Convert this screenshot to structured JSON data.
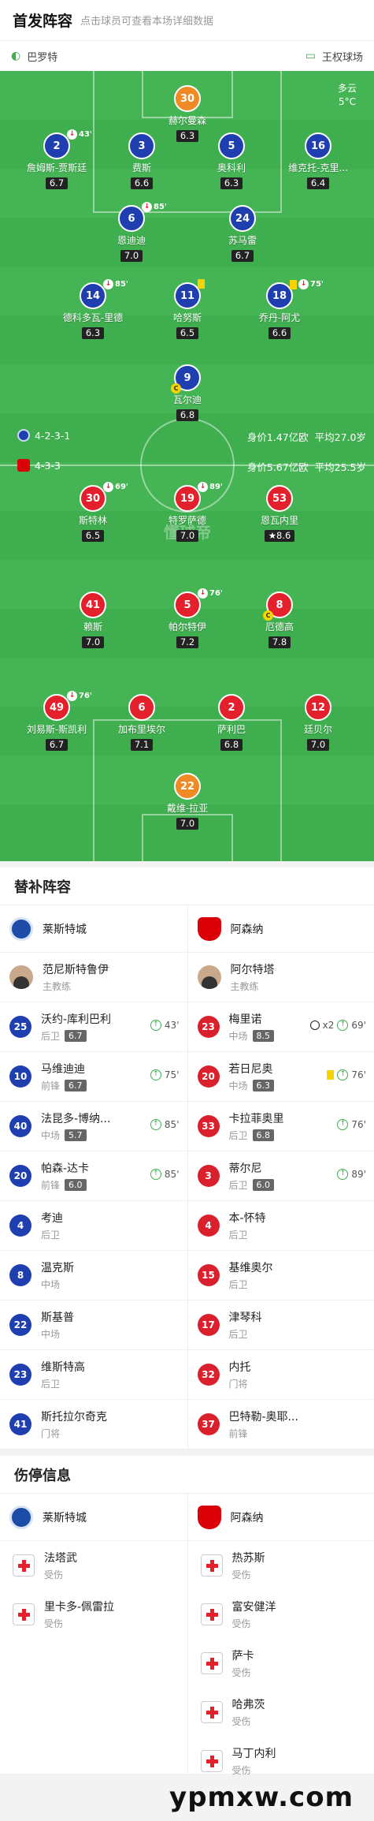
{
  "header": {
    "title": "首发阵容",
    "hint": "点击球员可查看本场详细数据"
  },
  "teambar": {
    "left": "巴罗特",
    "right": "王权球场"
  },
  "weather": {
    "condition": "多云",
    "temp": "5°C"
  },
  "home": {
    "formation": "4-2-3-1",
    "value": "身价1.47亿欧",
    "avg_age": "平均27.0岁",
    "players": [
      {
        "no": "30",
        "name": "赫尔曼森",
        "rating": "6.3",
        "keeper": true
      },
      {
        "no": "2",
        "name": "詹姆斯-贾斯廷",
        "rating": "6.7",
        "sub": "43'"
      },
      {
        "no": "3",
        "name": "费斯",
        "rating": "6.6"
      },
      {
        "no": "5",
        "name": "奥科利",
        "rating": "6.3"
      },
      {
        "no": "16",
        "name": "维克托-克里...",
        "rating": "6.4"
      },
      {
        "no": "6",
        "name": "恩迪迪",
        "rating": "7.0",
        "sub": "85'"
      },
      {
        "no": "24",
        "name": "苏马雷",
        "rating": "6.7"
      },
      {
        "no": "14",
        "name": "德科多瓦-里德",
        "rating": "6.3",
        "sub": "85'"
      },
      {
        "no": "11",
        "name": "哈努斯",
        "rating": "6.5",
        "yellow": true
      },
      {
        "no": "18",
        "name": "乔丹-阿尤",
        "rating": "6.6",
        "sub": "75'",
        "yellow": true
      },
      {
        "no": "9",
        "name": "瓦尔迪",
        "rating": "6.8",
        "captain": true
      }
    ]
  },
  "away": {
    "formation": "4-3-3",
    "value": "身价5.67亿欧",
    "avg_age": "平均25.5岁",
    "players": [
      {
        "no": "30",
        "name": "斯特林",
        "rating": "6.5",
        "sub": "69'"
      },
      {
        "no": "19",
        "name": "特罗萨德",
        "rating": "7.0",
        "sub": "89'"
      },
      {
        "no": "53",
        "name": "恩瓦内里",
        "rating": "8.6",
        "star": true
      },
      {
        "no": "41",
        "name": "赖斯",
        "rating": "7.0"
      },
      {
        "no": "5",
        "name": "帕尔特伊",
        "rating": "7.2",
        "sub": "76'"
      },
      {
        "no": "8",
        "name": "厄德高",
        "rating": "7.8",
        "captain": true
      },
      {
        "no": "49",
        "name": "刘易斯-斯凯利",
        "rating": "6.7",
        "sub": "76'"
      },
      {
        "no": "6",
        "name": "加布里埃尔",
        "rating": "7.1"
      },
      {
        "no": "2",
        "name": "萨利巴",
        "rating": "6.8"
      },
      {
        "no": "12",
        "name": "廷贝尔",
        "rating": "7.0"
      },
      {
        "no": "22",
        "name": "戴维-拉亚",
        "rating": "7.0",
        "keeper": true
      }
    ]
  },
  "watermark": "懂球帝",
  "subs": {
    "title": "替补阵容",
    "home_team": "莱斯特城",
    "away_team": "阿森纳",
    "home_coach": {
      "name": "范尼斯特鲁伊",
      "role": "主教练"
    },
    "away_coach": {
      "name": "阿尔特塔",
      "role": "主教练"
    },
    "home": [
      {
        "no": "25",
        "name": "沃约-库利巴利",
        "pos": "后卫",
        "rating": "6.7",
        "in": "43'"
      },
      {
        "no": "10",
        "name": "马维迪迪",
        "pos": "前锋",
        "rating": "6.7",
        "in": "75'"
      },
      {
        "no": "40",
        "name": "法昆多-博纳...",
        "pos": "中场",
        "rating": "5.7",
        "in": "85'"
      },
      {
        "no": "20",
        "name": "帕森-达卡",
        "pos": "前锋",
        "rating": "6.0",
        "in": "85'"
      },
      {
        "no": "4",
        "name": "考迪",
        "pos": "后卫"
      },
      {
        "no": "8",
        "name": "温克斯",
        "pos": "中场"
      },
      {
        "no": "22",
        "name": "斯基普",
        "pos": "中场"
      },
      {
        "no": "23",
        "name": "维斯特高",
        "pos": "后卫"
      },
      {
        "no": "41",
        "name": "斯托拉尔奇克",
        "pos": "门将"
      }
    ],
    "away": [
      {
        "no": "23",
        "name": "梅里诺",
        "pos": "中场",
        "rating": "8.5",
        "in": "69'",
        "goals": "x2"
      },
      {
        "no": "20",
        "name": "若日尼奥",
        "pos": "中场",
        "rating": "6.3",
        "in": "76'",
        "yellow": true
      },
      {
        "no": "33",
        "name": "卡拉菲奥里",
        "pos": "后卫",
        "rating": "6.8",
        "in": "76'"
      },
      {
        "no": "3",
        "name": "蒂尔尼",
        "pos": "后卫",
        "rating": "6.0",
        "in": "89'"
      },
      {
        "no": "4",
        "name": "本-怀特",
        "pos": "后卫"
      },
      {
        "no": "15",
        "name": "基维奥尔",
        "pos": "后卫"
      },
      {
        "no": "17",
        "name": "津琴科",
        "pos": "后卫"
      },
      {
        "no": "32",
        "name": "内托",
        "pos": "门将"
      },
      {
        "no": "37",
        "name": "巴特勒-奥耶...",
        "pos": "前锋"
      }
    ]
  },
  "injuries": {
    "title": "伤停信息",
    "home_team": "莱斯特城",
    "away_team": "阿森纳",
    "home": [
      {
        "name": "法塔武",
        "status": "受伤"
      },
      {
        "name": "里卡多-佩雷拉",
        "status": "受伤"
      }
    ],
    "away": [
      {
        "name": "热苏斯",
        "status": "受伤"
      },
      {
        "name": "富安健洋",
        "status": "受伤"
      },
      {
        "name": "萨卡",
        "status": "受伤"
      },
      {
        "name": "哈弗茨",
        "status": "受伤"
      },
      {
        "name": "马丁内利",
        "status": "受伤"
      }
    ]
  },
  "footer": {
    "brand": "ypmxw.com"
  },
  "colors": {
    "pitch": "#3fae4f",
    "home": "#1f3fb0",
    "away": "#e4202c",
    "keeper": "#f08a24"
  }
}
